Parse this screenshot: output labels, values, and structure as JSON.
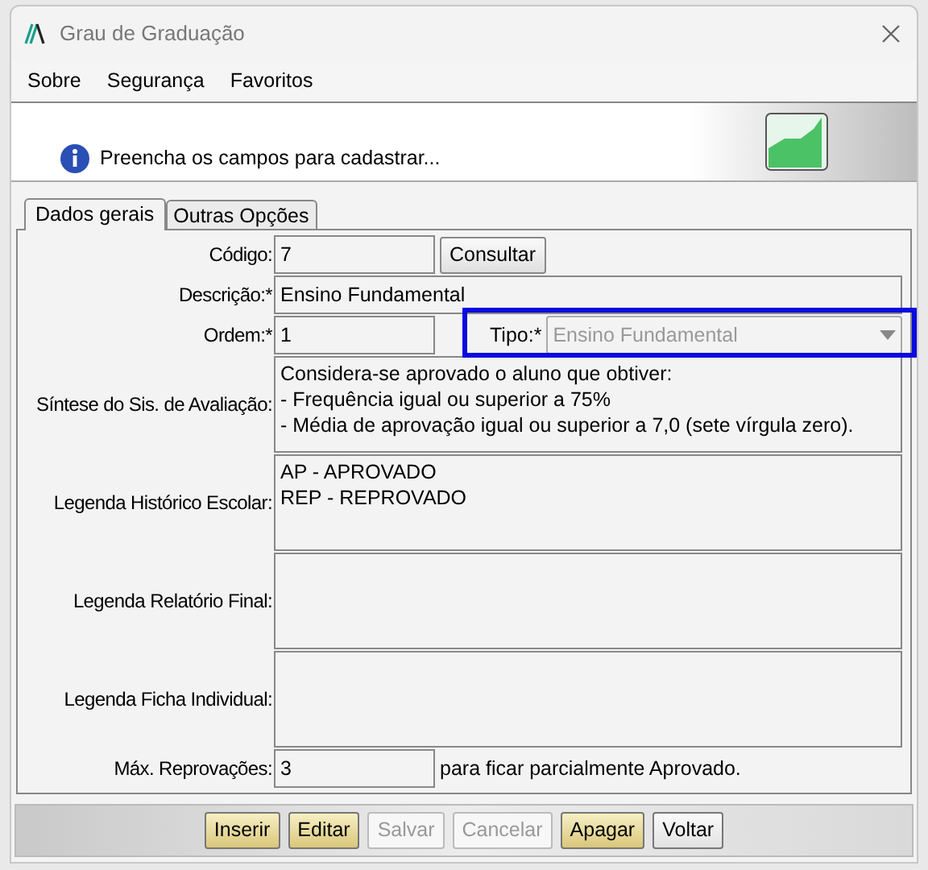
{
  "window": {
    "title": "Grau de Graduação"
  },
  "menu": [
    "Sobre",
    "Segurança",
    "Favoritos"
  ],
  "banner": {
    "message": "Preencha os campos para cadastrar..."
  },
  "tabs": [
    {
      "label": "Dados gerais",
      "selected": true
    },
    {
      "label": "Outras Opções",
      "selected": false
    }
  ],
  "form": {
    "codigo": {
      "label": "Código:",
      "value": "7",
      "button": "Consultar"
    },
    "descricao": {
      "label": "Descrição:*",
      "value": "Ensino Fundamental"
    },
    "ordem": {
      "label": "Ordem:*",
      "value": "1"
    },
    "tipo": {
      "label": "Tipo:*",
      "value": "Ensino Fundamental",
      "disabled": true,
      "highlighted": true
    },
    "textareas": [
      {
        "label": "Síntese do Sis. de Avaliação:",
        "lines": [
          "Considera-se aprovado o aluno que obtiver:",
          "- Frequência igual ou superior a 75%",
          "- Média de aprovação igual ou superior a 7,0 (sete vírgula zero)."
        ]
      },
      {
        "label": "Legenda Histórico Escolar:",
        "lines": [
          "AP - APROVADO",
          "REP - REPROVADO"
        ]
      },
      {
        "label": "Legenda Relatório Final:"
      },
      {
        "label": "Legenda Ficha Individual:"
      }
    ],
    "max": {
      "label": "Máx. Reprovações:",
      "value": "3",
      "suffix": "para ficar parcialmente Aprovado."
    }
  },
  "buttons": [
    {
      "label": "Inserir",
      "highlighted": true,
      "disabled": false
    },
    {
      "label": "Editar",
      "highlighted": true,
      "disabled": false
    },
    {
      "label": "Salvar",
      "disabled": true
    },
    {
      "label": "Cancelar",
      "disabled": true
    },
    {
      "label": "Apagar",
      "highlighted": true,
      "disabled": false
    },
    {
      "label": "Voltar",
      "highlighted": false,
      "disabled": false
    }
  ]
}
